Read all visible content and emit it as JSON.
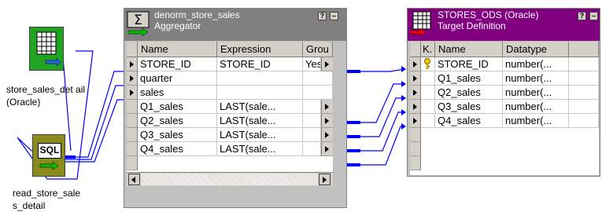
{
  "sources": {
    "store_sales": {
      "label": "store_sales_det ail (Oracle)",
      "icon": "table-icon"
    },
    "sql": {
      "label": "read_store_sale s_detail",
      "badge": "SQL",
      "icon": "sql-icon"
    }
  },
  "aggregator": {
    "title": "denorm_store_sales",
    "subtitle": "Aggregator",
    "icon": "sigma-icon",
    "columns": [
      "Name",
      "Expression",
      "Grou"
    ],
    "rows": [
      {
        "name": "STORE_ID",
        "expr": "STORE_ID",
        "group": "Yes"
      },
      {
        "name": "quarter",
        "expr": "",
        "group": ""
      },
      {
        "name": "sales",
        "expr": "",
        "group": ""
      },
      {
        "name": "Q1_sales",
        "expr": "LAST(sale...",
        "group": ""
      },
      {
        "name": "Q2_sales",
        "expr": "LAST(sale...",
        "group": ""
      },
      {
        "name": "Q3_sales",
        "expr": "LAST(sale...",
        "group": ""
      },
      {
        "name": "Q4_sales",
        "expr": "LAST(sale...",
        "group": ""
      }
    ]
  },
  "target": {
    "title": "STORES_ODS (Oracle)",
    "subtitle": "Target Definition",
    "icon": "target-table-icon",
    "columns": [
      "K.",
      "Name",
      "Datatype"
    ],
    "rows": [
      {
        "name": "STORE_ID",
        "type": "number(...",
        "key": true
      },
      {
        "name": "Q1_sales",
        "type": "number(...",
        "key": false
      },
      {
        "name": "Q2_sales",
        "type": "number(...",
        "key": false
      },
      {
        "name": "Q3_sales",
        "type": "number(...",
        "key": false
      },
      {
        "name": "Q4_sales",
        "type": "number(...",
        "key": false
      }
    ]
  },
  "colors": {
    "aggregator_header": "#808080",
    "target_header": "#800080",
    "link": "#0000ff"
  }
}
